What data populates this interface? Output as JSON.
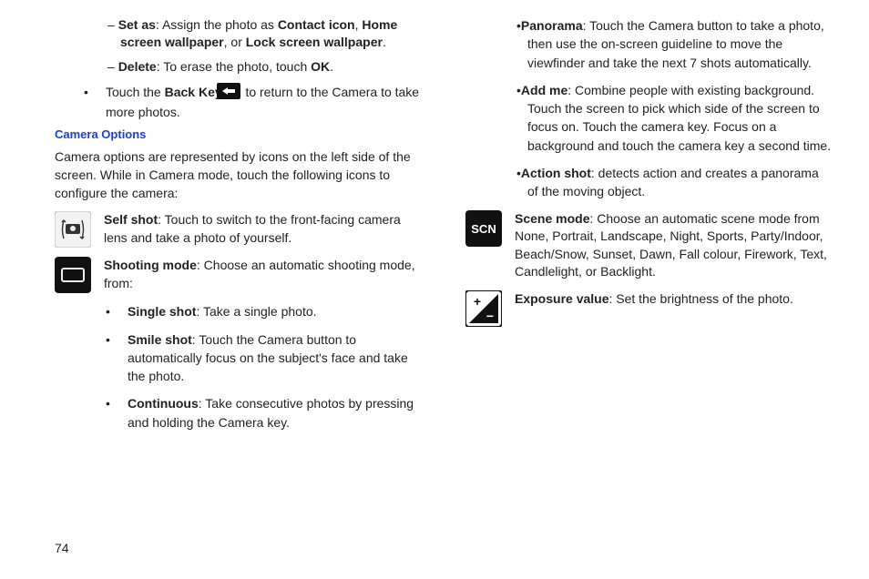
{
  "left": {
    "setas": {
      "lead": "Set as",
      "text": ": Assign the photo as ",
      "b1": "Contact icon",
      "sep": ", ",
      "b2": "Home screen wallpaper",
      "sep2": ", or ",
      "b3": "Lock screen wallpaper",
      "end": "."
    },
    "delete": {
      "lead": "Delete",
      "text": ": To erase the photo, touch ",
      "b": "OK",
      "end": "."
    },
    "backkey": {
      "pre": "Touch the ",
      "b": "Back Key",
      "post": " to return to the Camera to take more photos."
    },
    "section": "Camera Options",
    "intro": "Camera options are represented by icons on the left side of the screen. While in Camera mode, touch the following icons to configure the camera:",
    "selfshot": {
      "b": "Self shot",
      "t": ": Touch to switch to the front-facing camera lens and take a photo of yourself."
    },
    "shootingmode": {
      "b": "Shooting mode",
      "t": ": Choose an automatic shooting mode, from:"
    },
    "single": {
      "b": "Single shot",
      "t": ": Take a single photo."
    },
    "smile": {
      "b": "Smile shot",
      "t": ": Touch the Camera button to automatically focus on the subject's face and take the photo."
    },
    "cont": {
      "b": "Continuous",
      "t": ": Take consecutive photos by pressing and holding the Camera key."
    }
  },
  "right": {
    "pano": {
      "b": "Panorama",
      "t": ": Touch the Camera button to take a photo, then use the on-screen guideline to move the viewfinder and take the next 7 shots automatically."
    },
    "addme": {
      "b": "Add me",
      "t": ": Combine people with existing background. Touch the screen to pick which side of the screen to focus on. Touch the camera key. Focus on a background and touch the camera key a second time."
    },
    "action": {
      "b": "Action shot",
      "t": ": detects action and creates a panorama of the moving object."
    },
    "scene": {
      "b": "Scene mode",
      "t": ": Choose an automatic scene mode from None, Portrait, Landscape, Night, Sports, Party/Indoor, Beach/Snow, Sunset, Dawn, Fall colour, Firework, Text, Candlelight, or Backlight."
    },
    "exposure": {
      "b": "Exposure value",
      "t": ": Set the brightness of the photo."
    }
  },
  "pagenum": "74"
}
